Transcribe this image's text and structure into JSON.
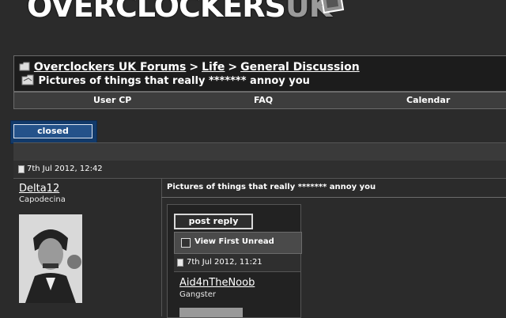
{
  "site": {
    "logo_main": "OVERCLOCKERS",
    "logo_suffix": "UK"
  },
  "breadcrumb": {
    "items": [
      "Overclockers UK Forums",
      "Life",
      "General Discussion"
    ],
    "separator": ">",
    "thread_title": "Pictures of things that really ******* annoy you"
  },
  "menu": {
    "items": [
      "User CP",
      "FAQ",
      "Calendar"
    ]
  },
  "thread_status": {
    "label": "closed"
  },
  "post": {
    "date": "7th Jul 2012, 12:42",
    "username": "Delta12",
    "user_title": "Capodecina",
    "title": "Pictures of things that really ******* annoy you"
  },
  "embedded_screenshot": {
    "reply_button": "post reply",
    "view_first_unread": "View First Unread",
    "date": "7th Jul 2012, 11:21",
    "username": "Aid4nTheNoob",
    "user_title": "Gangster"
  },
  "colors": {
    "background": "#2b2b2b",
    "closed_button": "#24528a",
    "text": "#ffffff"
  }
}
